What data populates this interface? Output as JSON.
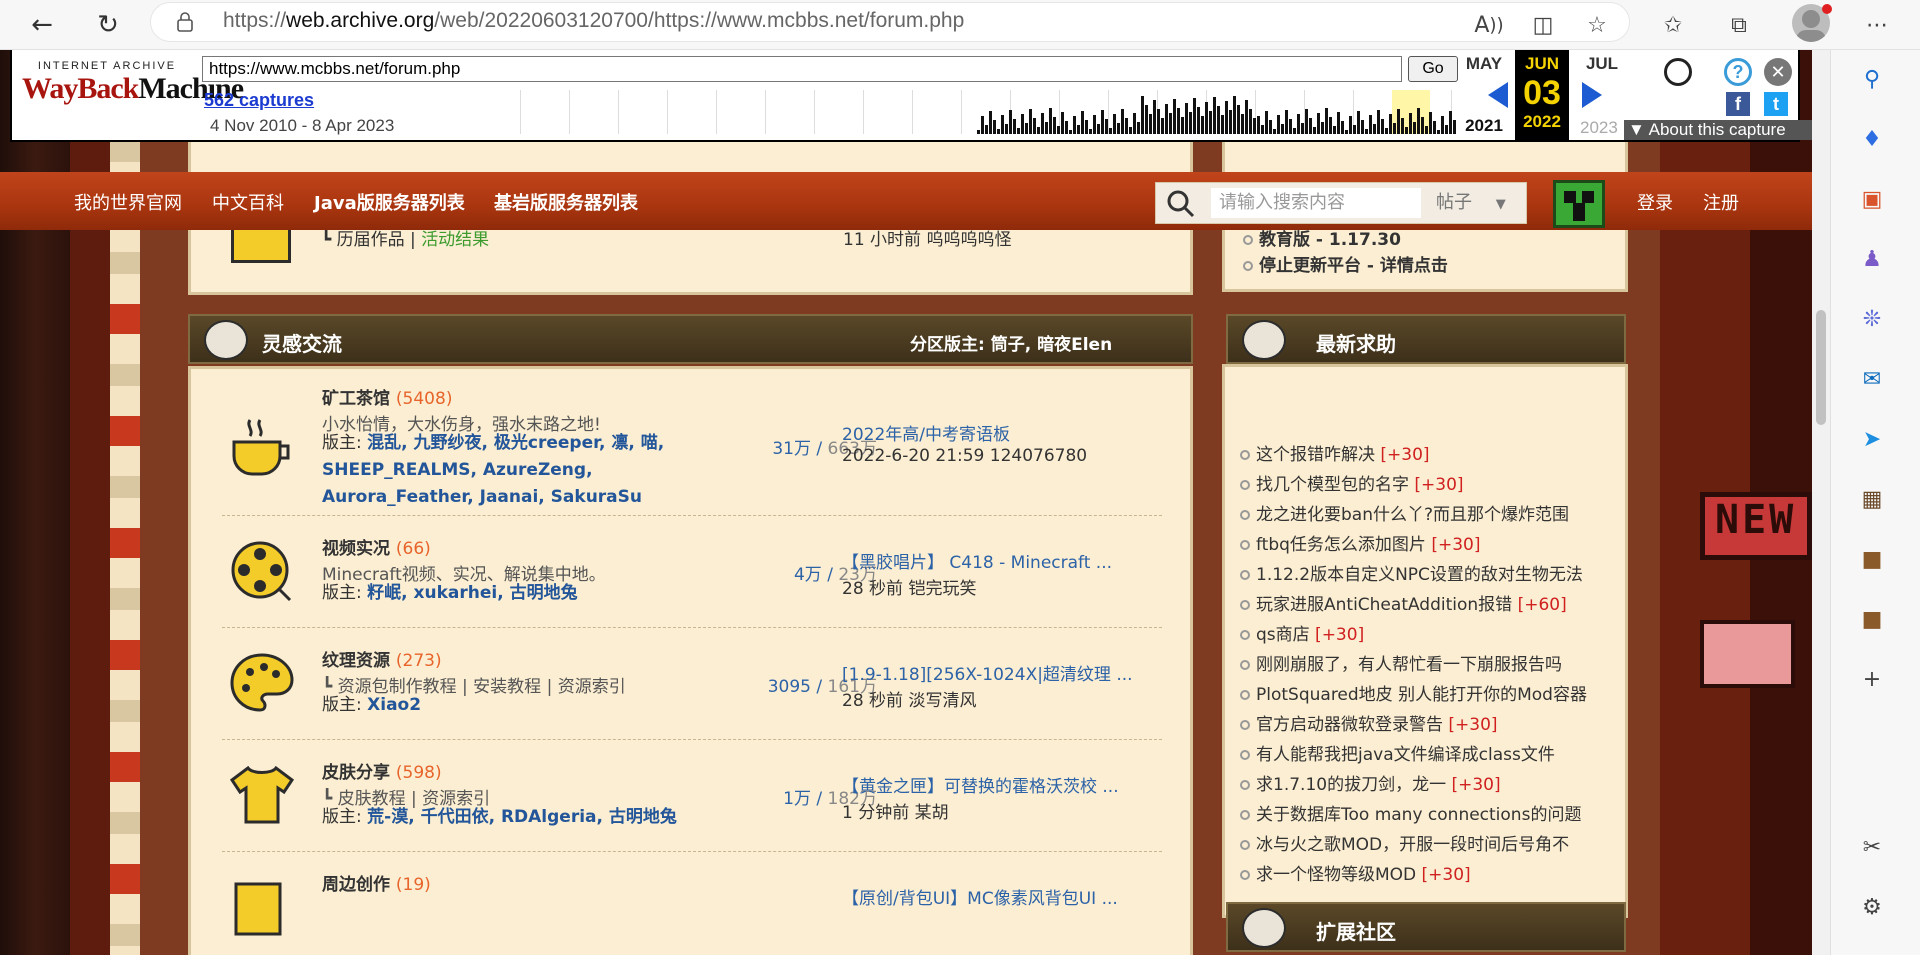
{
  "browser": {
    "url_prefix": "https://",
    "url_host": "web.archive.org",
    "url_rest": "/web/20220603120700/https://www.mcbbs.net/forum.php"
  },
  "wayback": {
    "brand_top": "INTERNET ARCHIVE",
    "brand_wayback": "WayBack",
    "brand_machine": "Machine",
    "url_value": "https://www.mcbbs.net/forum.php",
    "go_label": "Go",
    "captures": "562 captures",
    "range": "4 Nov 2010 - 8 Apr 2023",
    "prev_month": "MAY",
    "cur_month": "JUN",
    "next_month": "JUL",
    "prev_year": "2021",
    "cur_day": "03",
    "cur_year": "2022",
    "next_year": "2023",
    "about": "About this capture",
    "social_fb": "f",
    "social_tw": "t",
    "help": "?"
  },
  "nav": {
    "links": [
      "我的世界官网",
      "中文百科",
      "Java版服务器列表",
      "基岩版服务器列表"
    ],
    "search_placeholder": "请输入搜索内容",
    "search_type": "帖子",
    "login": "登录",
    "register": "注册"
  },
  "top_partial": {
    "text": "历届作品",
    "link": "活动结果",
    "last": "11 小时前 呜呜呜呜怪"
  },
  "section": {
    "title": "灵感交流",
    "moderators_label": "分区版主:",
    "moderators": "筒子, 暗夜Elen"
  },
  "forums": [
    {
      "name": "矿工茶馆",
      "count": "(5408)",
      "desc": "小水怡情，大水伤身，强水末路之地!",
      "mods_label": "版主:",
      "mods": "混乱, 九野纱夜, 极光creeper, 凛, 喵,",
      "mods2": "SHEEP_REALMS, AzureZeng,",
      "mods3": "Aurora_Feather, Jaanai, SakuraSu",
      "topics": "31万",
      "posts": "663万",
      "last_title": "2022年高/中考寄语板",
      "last_meta": "2022-6-20 21:59 124076780"
    },
    {
      "name": "视频实况",
      "count": "(66)",
      "desc": "Minecraft视频、实况、解说集中地。",
      "mods_label": "版主:",
      "mods": "籽岷, xukarhei, 古明地兔",
      "topics": "4万",
      "posts": "23万",
      "last_title": "【黑胶唱片】 C418 - Minecraft ...",
      "last_meta": "28 秒前 铠完玩笑"
    },
    {
      "name": "纹理资源",
      "count": "(273)",
      "desc": "资源包制作教程 | 安装教程 | 资源索引",
      "mods_label": "版主:",
      "mods": "Xiao2",
      "topics": "3095",
      "posts": "161万",
      "last_title": "[1.9-1.18][256X-1024X|超清纹理 ...",
      "last_meta": "28 秒前 淡写清风"
    },
    {
      "name": "皮肤分享",
      "count": "(598)",
      "desc": "皮肤教程 | 资源索引",
      "mods_label": "版主:",
      "mods": "荒-漠, 千代田依, RDAlgeria, 古明地兔",
      "topics": "1万",
      "posts": "182万",
      "last_title": "【黄金之匣】可替换的霍格沃茨校 ...",
      "last_meta": "1 分钟前 某胡"
    },
    {
      "name": "周边创作",
      "count": "(19)",
      "last_title": "【原创/背包UI】MC像素风背包UI ..."
    }
  ],
  "side_top": {
    "item1": "教育版 - 1.17.30",
    "item2": "停止更新平台 - 详情点击"
  },
  "help_panel": {
    "title": "最新求助",
    "items": [
      {
        "text": "这个报错咋解决",
        "reward": "[+30]"
      },
      {
        "text": "找几个模型包的名字",
        "reward": "[+30]"
      },
      {
        "text": "龙之进化要ban什么丫?而且那个爆炸范围",
        "reward": ""
      },
      {
        "text": "ftbq任务怎么添加图片",
        "reward": "[+30]"
      },
      {
        "text": "1.12.2版本自定义NPC设置的敌对生物无法",
        "reward": ""
      },
      {
        "text": "玩家进服AntiCheatAddition报错",
        "reward": "[+60]"
      },
      {
        "text": "qs商店",
        "reward": "[+30]"
      },
      {
        "text": "刚刚崩服了，有人帮忙看一下崩服报告吗",
        "reward": ""
      },
      {
        "text": "PlotSquared地皮 别人能打开你的Mod容器",
        "reward": ""
      },
      {
        "text": "官方启动器微软登录警告",
        "reward": "[+30]"
      },
      {
        "text": "有人能帮我把java文件编译成class文件",
        "reward": ""
      },
      {
        "text": "求1.7.10的拔刀剑，龙一",
        "reward": "[+30]"
      },
      {
        "text": "关于数据库Too many connections的问题",
        "reward": ""
      },
      {
        "text": "冰与火之歌MOD，开服一段时间后号角不",
        "reward": ""
      },
      {
        "text": "求一个怪物等级MOD",
        "reward": "[+30]"
      }
    ]
  },
  "ext_panel": {
    "title": "扩展社区"
  },
  "signs": {
    "new": "NEW"
  },
  "icons": {
    "back": "arrow-left",
    "reload": "reload",
    "lock": "lock",
    "read": "read-aloud",
    "split": "split-screen",
    "fav-add": "star-plus",
    "favorites": "star-list",
    "collections": "collections",
    "profile": "avatar",
    "more": "ellipsis"
  }
}
